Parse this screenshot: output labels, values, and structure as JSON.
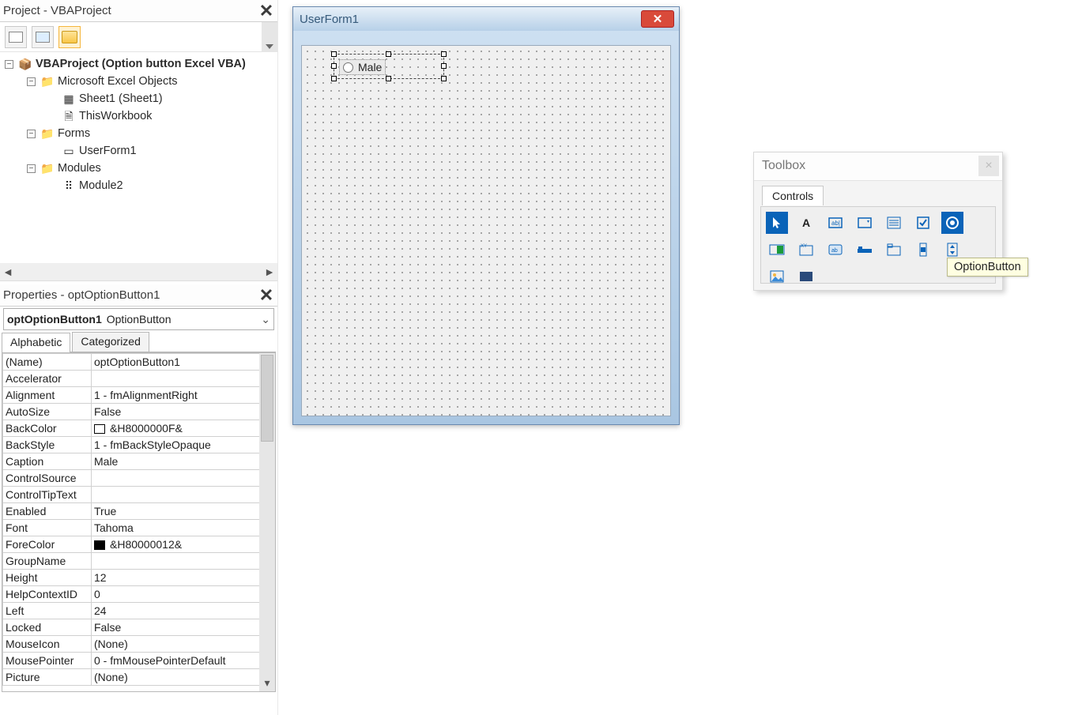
{
  "project_pane": {
    "title": "Project - VBAProject",
    "root": "VBAProject (Option button Excel VBA)",
    "nodes": {
      "excel_objects": "Microsoft Excel Objects",
      "sheet1": "Sheet1 (Sheet1)",
      "thisworkbook": "ThisWorkbook",
      "forms": "Forms",
      "userform1": "UserForm1",
      "modules": "Modules",
      "module2": "Module2"
    }
  },
  "properties_pane": {
    "title": "Properties - optOptionButton1",
    "object_name": "optOptionButton1",
    "object_type": "OptionButton",
    "tabs": {
      "alphabetic": "Alphabetic",
      "categorized": "Categorized"
    },
    "rows": [
      {
        "name": "(Name)",
        "value": "optOptionButton1"
      },
      {
        "name": "Accelerator",
        "value": ""
      },
      {
        "name": "Alignment",
        "value": "1 - fmAlignmentRight"
      },
      {
        "name": "AutoSize",
        "value": "False"
      },
      {
        "name": "BackColor",
        "value": "&H8000000F&",
        "swatch": "#ffffff"
      },
      {
        "name": "BackStyle",
        "value": "1 - fmBackStyleOpaque"
      },
      {
        "name": "Caption",
        "value": "Male"
      },
      {
        "name": "ControlSource",
        "value": ""
      },
      {
        "name": "ControlTipText",
        "value": ""
      },
      {
        "name": "Enabled",
        "value": "True"
      },
      {
        "name": "Font",
        "value": "Tahoma"
      },
      {
        "name": "ForeColor",
        "value": "&H80000012&",
        "swatch": "#000000"
      },
      {
        "name": "GroupName",
        "value": ""
      },
      {
        "name": "Height",
        "value": "12"
      },
      {
        "name": "HelpContextID",
        "value": "0"
      },
      {
        "name": "Left",
        "value": "24"
      },
      {
        "name": "Locked",
        "value": "False"
      },
      {
        "name": "MouseIcon",
        "value": "(None)"
      },
      {
        "name": "MousePointer",
        "value": "0 - fmMousePointerDefault"
      },
      {
        "name": "Picture",
        "value": "(None)"
      }
    ]
  },
  "userform": {
    "title": "UserForm1",
    "control_caption": "Male"
  },
  "toolbox": {
    "title": "Toolbox",
    "tab": "Controls",
    "tooltip": "OptionButton"
  }
}
